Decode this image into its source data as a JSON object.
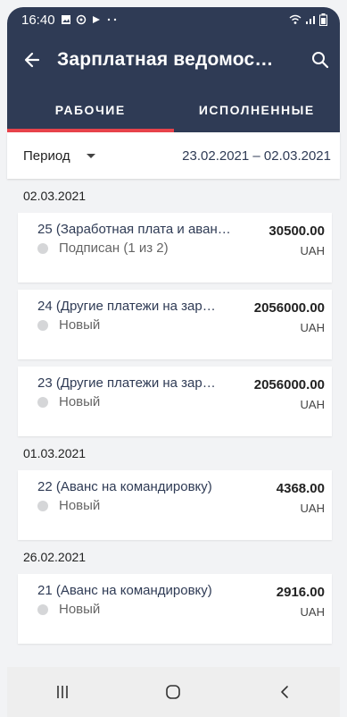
{
  "status_bar": {
    "time": "16:40",
    "left_icons": [
      "gallery-icon",
      "whatsapp-icon",
      "play-icon",
      "more-dots-icon"
    ],
    "right_icons": [
      "wifi-icon",
      "signal-icon",
      "battery-icon"
    ]
  },
  "app_bar": {
    "title": "Зарплатная ведомос…"
  },
  "tabs": [
    {
      "label": "РАБОЧИЕ",
      "active": true
    },
    {
      "label": "ИСПОЛНЕННЫЕ",
      "active": false
    }
  ],
  "filter": {
    "period_label": "Период",
    "date_range": "23.02.2021 – 02.03.2021"
  },
  "groups": [
    {
      "date": "02.03.2021",
      "items": [
        {
          "name": "25 (Заработная плата и аван…",
          "status": "Подписан (1 из 2)",
          "amount": "30500.00",
          "currency": "UAH"
        },
        {
          "name": "24 (Другие платежи на зар…",
          "status": "Новый",
          "amount": "2056000.00",
          "currency": "UAH"
        },
        {
          "name": "23 (Другие платежи на зар…",
          "status": "Новый",
          "amount": "2056000.00",
          "currency": "UAH"
        }
      ]
    },
    {
      "date": "01.03.2021",
      "items": [
        {
          "name": "22 (Аванс на командировку)",
          "status": "Новый",
          "amount": "4368.00",
          "currency": "UAH"
        }
      ]
    },
    {
      "date": "26.02.2021",
      "items": [
        {
          "name": "21 (Аванс на командировку)",
          "status": "Новый",
          "amount": "2916.00",
          "currency": "UAH"
        }
      ]
    }
  ],
  "colors": {
    "primary": "#2f3b55",
    "accent": "#e8434b",
    "background": "#f2f3f5"
  },
  "nav_bar": {
    "buttons": [
      "recent-apps-icon",
      "home-icon",
      "back-icon"
    ]
  }
}
